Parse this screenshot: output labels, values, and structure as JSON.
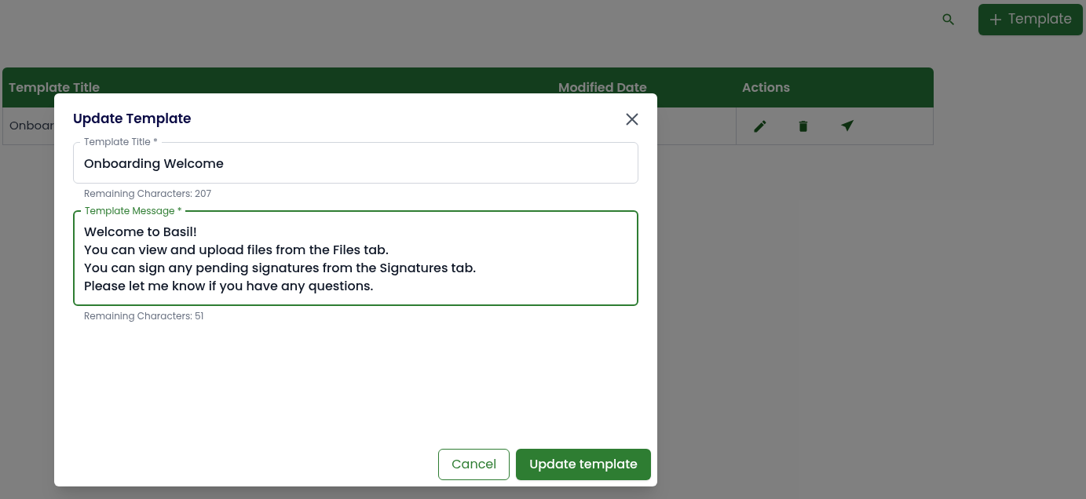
{
  "toolbar": {
    "add_button": "Template"
  },
  "table": {
    "columns": [
      "Template Title",
      "Modified Date",
      "Actions"
    ],
    "rows": [
      {
        "title": "Onboar"
      }
    ]
  },
  "dialog": {
    "title": "Update Template",
    "fields": [
      {
        "label": "Template Title *",
        "focused": false,
        "lines": [
          "Onboarding Welcome"
        ],
        "helper": "Remaining Characters: 207"
      },
      {
        "label": "Template Message *",
        "focused": true,
        "lines": [
          "Welcome to Basil!",
          "You can view and upload files from the Files tab.",
          "You can sign any pending signatures from the Signatures tab.",
          "Please let me know if you have any questions."
        ],
        "helper": "Remaining Characters: 51"
      }
    ],
    "buttons": [
      {
        "kind": "outlined",
        "label": "Cancel"
      },
      {
        "kind": "filled",
        "label": "Update template"
      }
    ]
  }
}
